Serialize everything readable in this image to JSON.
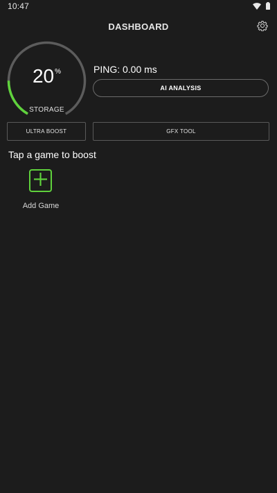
{
  "status_bar": {
    "time": "10:47",
    "icons": [
      "wifi-icon",
      "battery-icon"
    ]
  },
  "header": {
    "title": "DASHBOARD",
    "settings_icon": "gear-icon"
  },
  "storage_gauge": {
    "value": "20",
    "unit": "%",
    "label": "STORAGE",
    "fraction": 0.2
  },
  "ping": {
    "text": "PING: 0.00 ms"
  },
  "buttons": {
    "ai_analysis": "AI ANALYSIS",
    "ultra_boost": "ULTRA BOOST",
    "gfx_tool": "GFX TOOL"
  },
  "games": {
    "title": "Tap a game to boost",
    "add_label": "Add Game",
    "add_icon": "plus-icon"
  },
  "colors": {
    "background": "#1c1c1c",
    "accent": "#5fd23c",
    "gauge_track": "#5c5c5c"
  }
}
